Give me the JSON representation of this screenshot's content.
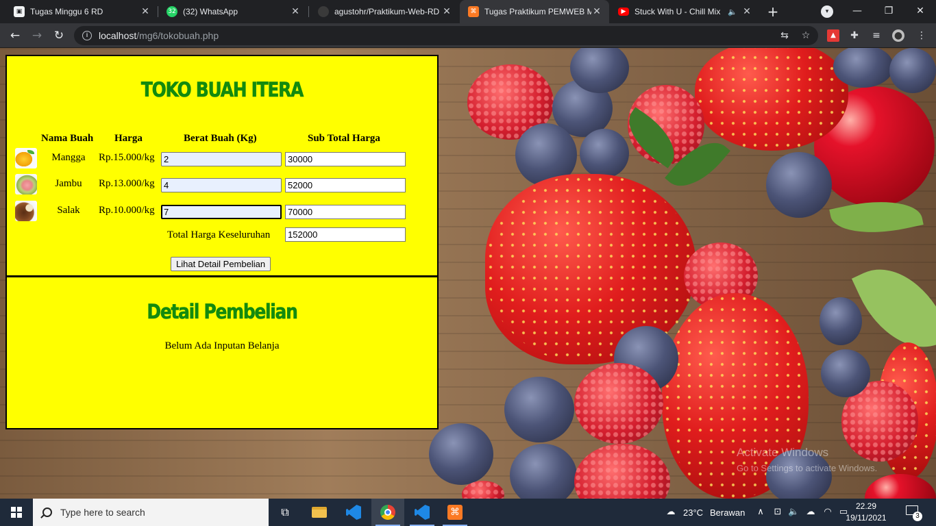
{
  "browser": {
    "tabs": [
      {
        "title": "Tugas Minggu 6 RD",
        "favicon": "classroom-icon",
        "color": "#f1f3f4"
      },
      {
        "title": "(32) WhatsApp",
        "favicon": "whatsapp-icon",
        "badge": "32",
        "color": "#25d366"
      },
      {
        "title": "agustohr/Praktikum-Web-RD",
        "favicon": "github-icon",
        "color": "#d0d0d0"
      },
      {
        "title": "Tugas Praktikum PEMWEB M",
        "favicon": "xampp-icon",
        "color": "#fb7a24",
        "active": true
      },
      {
        "title": "Stuck With U - Chill Mix",
        "favicon": "youtube-icon",
        "color": "#ff0000"
      }
    ],
    "address": {
      "host": "localhost",
      "path": "/mg6/tokobuah.php"
    }
  },
  "store": {
    "title": "TOKO BUAH ITERA",
    "columns": {
      "name": "Nama Buah",
      "price": "Harga",
      "weight": "Berat Buah (Kg)",
      "subtotal": "Sub Total Harga"
    },
    "items": [
      {
        "name": "Mangga",
        "price": "Rp.15.000/kg",
        "weight": "2",
        "subtotal": "30000",
        "image": "mango-thumbnail"
      },
      {
        "name": "Jambu",
        "price": "Rp.13.000/kg",
        "weight": "4",
        "subtotal": "52000",
        "image": "guava-thumbnail"
      },
      {
        "name": "Salak",
        "price": "Rp.10.000/kg",
        "weight": "7",
        "subtotal": "70000",
        "image": "salak-thumbnail"
      }
    ],
    "total_label": "Total Harga Keseluruhan",
    "total_value": "152000",
    "button_label": "Lihat Detail Pembelian"
  },
  "detail": {
    "title": "Detail Pembelian",
    "empty_message": "Belum Ada Inputan Belanja"
  },
  "watermark": {
    "line1": "Activate Windows",
    "line2": "Go to Settings to activate Windows."
  },
  "taskbar": {
    "search_placeholder": "Type here to search",
    "weather_temp": "23°C",
    "weather_desc": "Berawan",
    "time": "22.29",
    "date": "19/11/2021",
    "notification_count": "3"
  },
  "colors": {
    "panel_bg": "#ffff00",
    "heading": "#138a0e",
    "taskbar": "#1f2a3a"
  }
}
